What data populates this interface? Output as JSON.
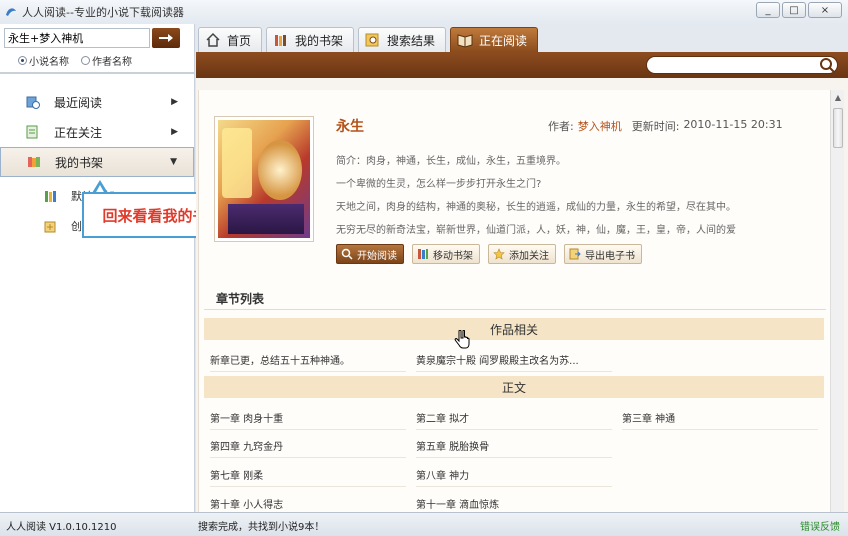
{
  "window": {
    "title": "人人阅读--专业的小说下载阅读器",
    "minimize": "_",
    "maximize": "□",
    "close": "×"
  },
  "sidebar": {
    "search_value": "永生+梦入神机",
    "radio_options": [
      "小说名称",
      "作者名称"
    ],
    "items": [
      {
        "label": "最近阅读"
      },
      {
        "label": "正在关注"
      },
      {
        "label": "我的书架"
      }
    ],
    "sub_items": [
      {
        "label": "默认书架"
      },
      {
        "label": "创建书架"
      }
    ],
    "tooltip": "回来看看我的书架！"
  },
  "tabs": [
    {
      "label": "首页"
    },
    {
      "label": "我的书架"
    },
    {
      "label": "搜索结果"
    },
    {
      "label": "正在阅读"
    }
  ],
  "book": {
    "title": "永生",
    "author_label": "作者:",
    "author": "梦入神机",
    "updated_label": "更新时间:",
    "updated": "2010-11-15 20:31",
    "description": [
      "简介：肉身，神通，长生，成仙，永生，五重境界。",
      "一个卑微的生灵，怎么样一步步打开永生之门?",
      "天地之间，肉身的结构，神通的奥秘，长生的逍遥，成仙的力量，永生的希望，尽在其中。",
      "无穷无尽的新奇法宝，崭新世界，仙道门派，人，妖，神，仙，魔，王，皇，帝，人间的爱"
    ],
    "actions": [
      "开始阅读",
      "移动书架",
      "添加关注",
      "导出电子书"
    ]
  },
  "chapters": {
    "heading": "章节列表",
    "section_related": "作品相关",
    "related": [
      "新章已更，总结五十五种神通。",
      "黄泉魔宗十殿 阎罗殿殿主改名为苏..."
    ],
    "section_main": "正文",
    "main": [
      "第一章 肉身十重",
      "第二章 拟才",
      "第三章 神通",
      "第四章 九窍金丹",
      "第五章 脱胎换骨",
      "第七章 刚柔",
      "第八章 神力",
      "第十章 小人得志",
      "第十一章 滴血惊炼"
    ]
  },
  "status": {
    "version": "人人阅读 V1.0.10.1210",
    "message": "搜索完成，共找到小说9本！",
    "feedback": "错误反馈"
  },
  "colors": {
    "accent_brown": "#8d4c1f",
    "title_orange": "#b3521a",
    "tooltip_red": "#e03a2a",
    "tooltip_border": "#4a9ed6"
  }
}
